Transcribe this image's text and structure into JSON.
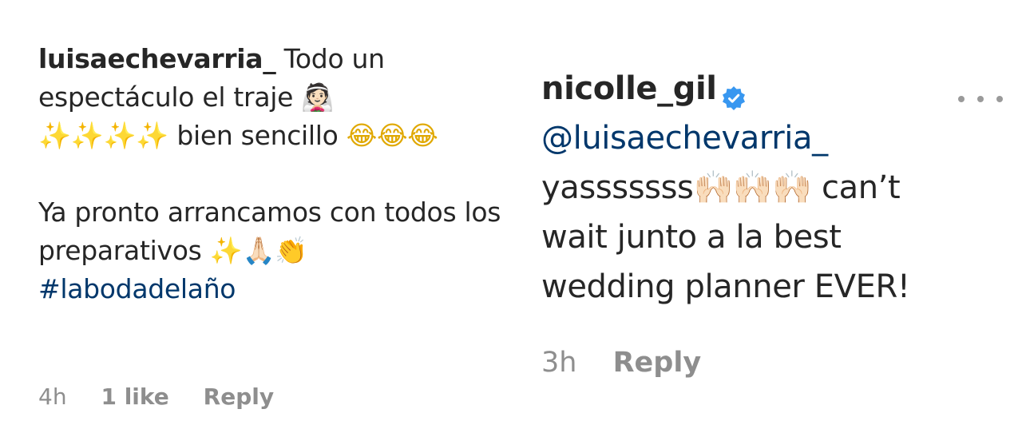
{
  "left_comment": {
    "username": "luisaechevarria_",
    "text_line1": "Todo un espectáculo el traje",
    "emoji_bride": "👰🏻",
    "emoji_sparkles": "✨✨✨✨",
    "text_line2": "bien sencillo",
    "emoji_laugh": "😂😂😂",
    "text_para2": "Ya pronto arrancamos con todos los preparativos",
    "emoji_para2": "✨🙏🏻👏",
    "hashtag": "#labodadelaño",
    "time": "4h",
    "likes": "1 like",
    "reply": "Reply"
  },
  "right_comment": {
    "username": "nicolle_gil",
    "verified_color": "#3897f0",
    "mention": "@luisaechevarria_",
    "text_part1": "yasssssss",
    "emoji_hands": "🙌🏻🙌🏻🙌🏻",
    "text_part2": "can’t wait junto a la best wedding planner EVER!",
    "time": "3h",
    "reply": "Reply"
  },
  "icons": {
    "more": "more-options-icon",
    "verified": "verified-badge-icon"
  }
}
